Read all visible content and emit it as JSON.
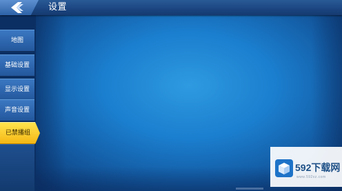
{
  "header": {
    "title": "设置",
    "back_icon": "back-arrow-icon"
  },
  "sidebar": {
    "items": [
      {
        "label": "地图",
        "active": false
      },
      {
        "label": "基础设置",
        "active": false
      },
      {
        "label": "显示设置",
        "active": false
      },
      {
        "label": "声音设置",
        "active": false
      },
      {
        "label": "已禁播组",
        "active": true
      }
    ]
  },
  "watermark": {
    "brand": "592下载网",
    "url": "www.592xz.com",
    "logo_icon": "cube-logo-icon"
  },
  "colors": {
    "header": "#1b4580",
    "sidebar_item": "#2b62a8",
    "active_item": "#f7c21f",
    "content_center": "#2e9ae0"
  }
}
